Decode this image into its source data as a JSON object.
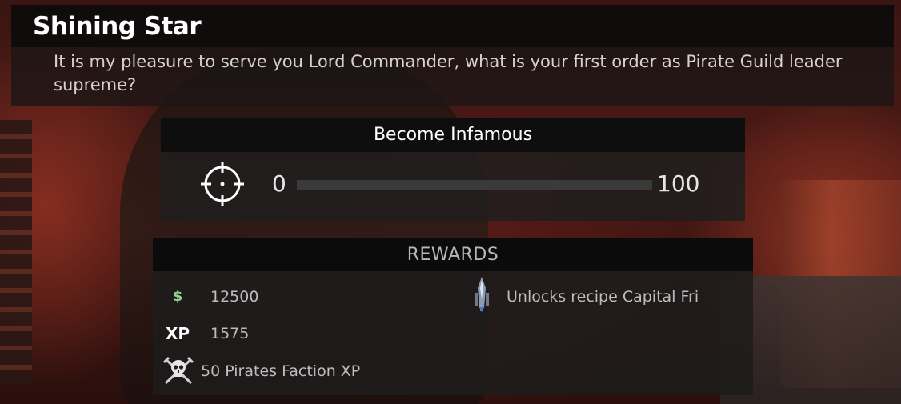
{
  "dialog": {
    "speaker": "Shining Star",
    "text": "It is my pleasure to serve you Lord Commander, what is your first order as Pirate Guild leader supreme?"
  },
  "objective": {
    "title": "Become Infamous",
    "icon": "crosshair-icon",
    "progress": {
      "current": 0,
      "min_label": "0",
      "max_label": "100",
      "fraction": 0.0
    }
  },
  "rewards": {
    "heading": "REWARDS",
    "money": {
      "icon_glyph": "$",
      "icon": "dollar-icon",
      "value": "12500"
    },
    "xp": {
      "icon_glyph": "XP",
      "icon": "xp-icon",
      "value": "1575"
    },
    "faction": {
      "icon": "skull-crossed-swords-icon",
      "text": "50 Pirates Faction XP"
    },
    "recipe": {
      "icon": "capital-ship-recipe-icon",
      "text": "Unlocks recipe Capital Fri"
    }
  },
  "colors": {
    "money_icon": "#8fd48f",
    "panel_header": "#0c0c0c",
    "text_primary": "#ffffff",
    "text_secondary": "#bdbdbd"
  }
}
